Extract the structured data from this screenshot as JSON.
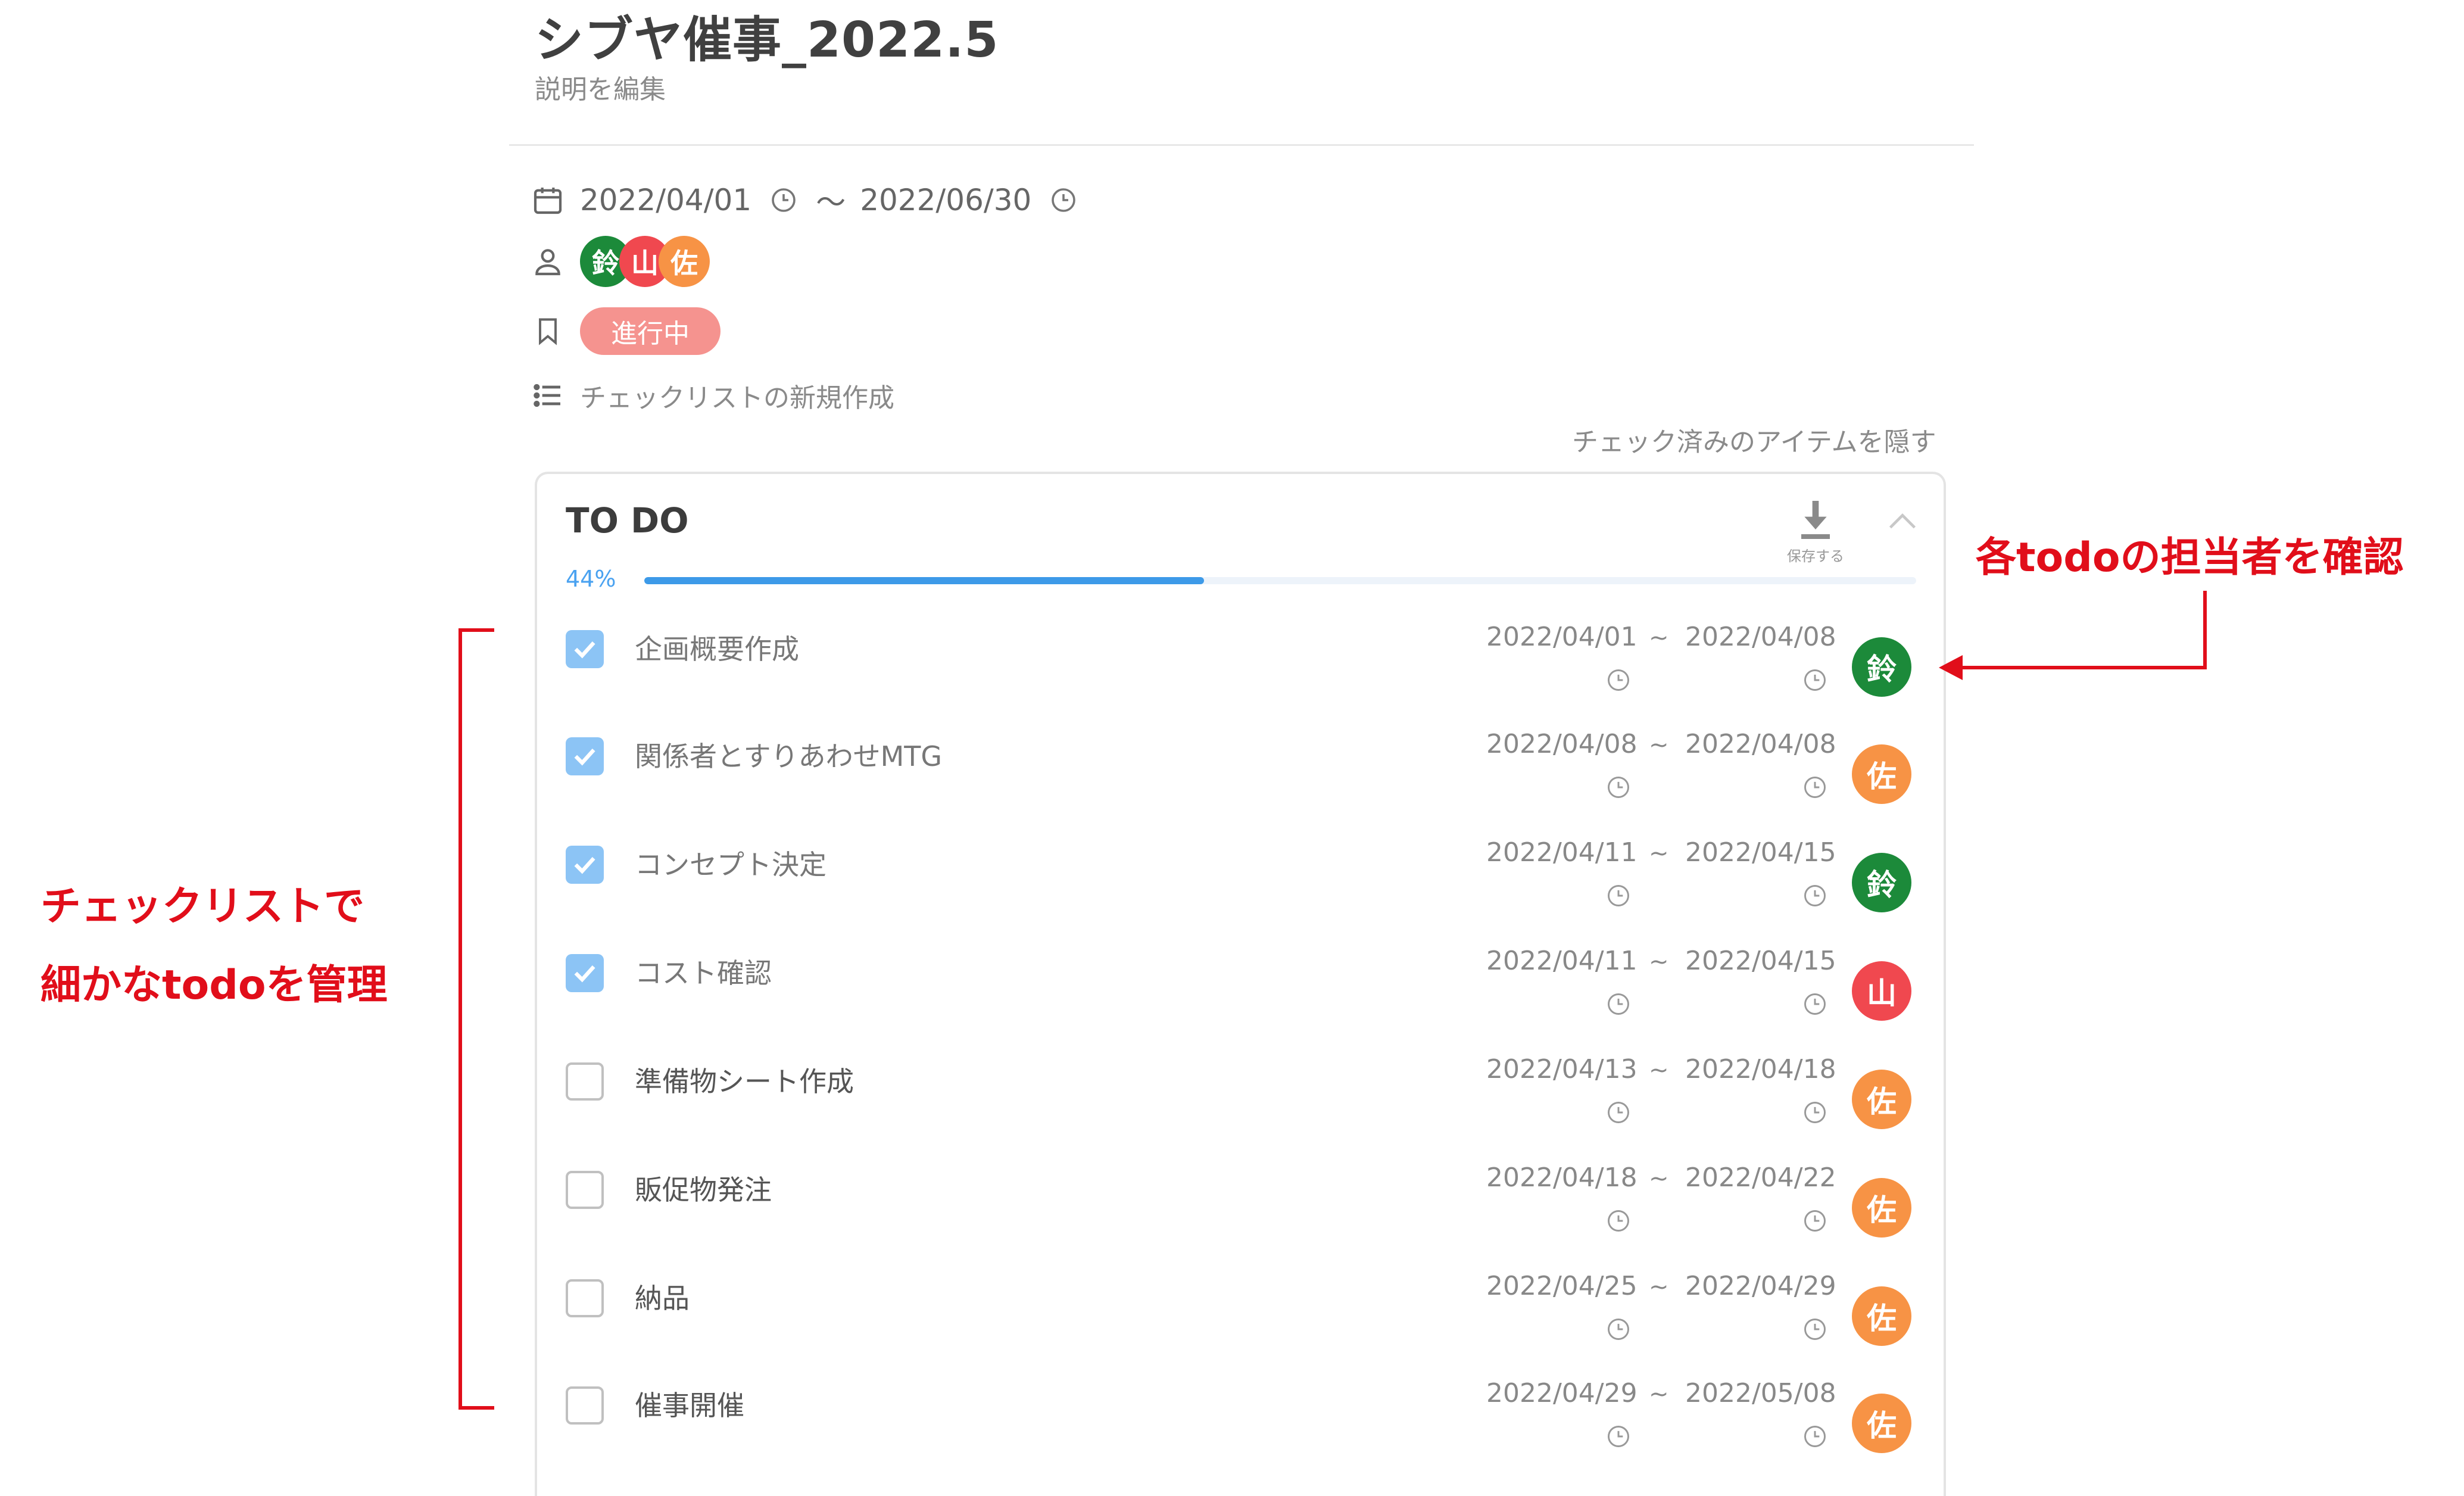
{
  "header": {
    "title": "シブヤ催事_2022.5",
    "edit_description": "説明を編集"
  },
  "meta": {
    "start_date": "2022/04/01",
    "range_sep": "～",
    "end_date": "2022/06/30",
    "members": [
      {
        "initial": "鈴",
        "color": "#1c8a3a"
      },
      {
        "initial": "山",
        "color": "#f0484f"
      },
      {
        "initial": "佐",
        "color": "#f79345"
      }
    ],
    "status": "進行中",
    "new_checklist": "チェックリストの新規作成"
  },
  "hide_checked": "チェック済みのアイテムを隠す",
  "checklist": {
    "title": "TO DO",
    "save_label": "保存する",
    "progress_label": "44%",
    "progress": 0.44,
    "date_sep": "~",
    "items": [
      {
        "label": "企画概要作成",
        "checked": true,
        "start": "2022/04/01",
        "end": "2022/04/08",
        "assignee": "鈴",
        "assignee_color": "#1c8a3a"
      },
      {
        "label": "関係者とすりあわせMTG",
        "checked": true,
        "start": "2022/04/08",
        "end": "2022/04/08",
        "assignee": "佐",
        "assignee_color": "#f79345"
      },
      {
        "label": "コンセプト決定",
        "checked": true,
        "start": "2022/04/11",
        "end": "2022/04/15",
        "assignee": "鈴",
        "assignee_color": "#1c8a3a"
      },
      {
        "label": "コスト確認",
        "checked": true,
        "start": "2022/04/11",
        "end": "2022/04/15",
        "assignee": "山",
        "assignee_color": "#f0484f"
      },
      {
        "label": "準備物シート作成",
        "checked": false,
        "start": "2022/04/13",
        "end": "2022/04/18",
        "assignee": "佐",
        "assignee_color": "#f79345"
      },
      {
        "label": "販促物発注",
        "checked": false,
        "start": "2022/04/18",
        "end": "2022/04/22",
        "assignee": "佐",
        "assignee_color": "#f79345"
      },
      {
        "label": "納品",
        "checked": false,
        "start": "2022/04/25",
        "end": "2022/04/29",
        "assignee": "佐",
        "assignee_color": "#f79345"
      },
      {
        "label": "催事開催",
        "checked": false,
        "start": "2022/04/29",
        "end": "2022/05/08",
        "assignee": "佐",
        "assignee_color": "#f79345"
      }
    ]
  },
  "annotations": {
    "left_line1": "チェックリストで",
    "left_line2": "細かなtodoを管理",
    "right": "各todoの担当者を確認",
    "color": "#e10e1a"
  }
}
